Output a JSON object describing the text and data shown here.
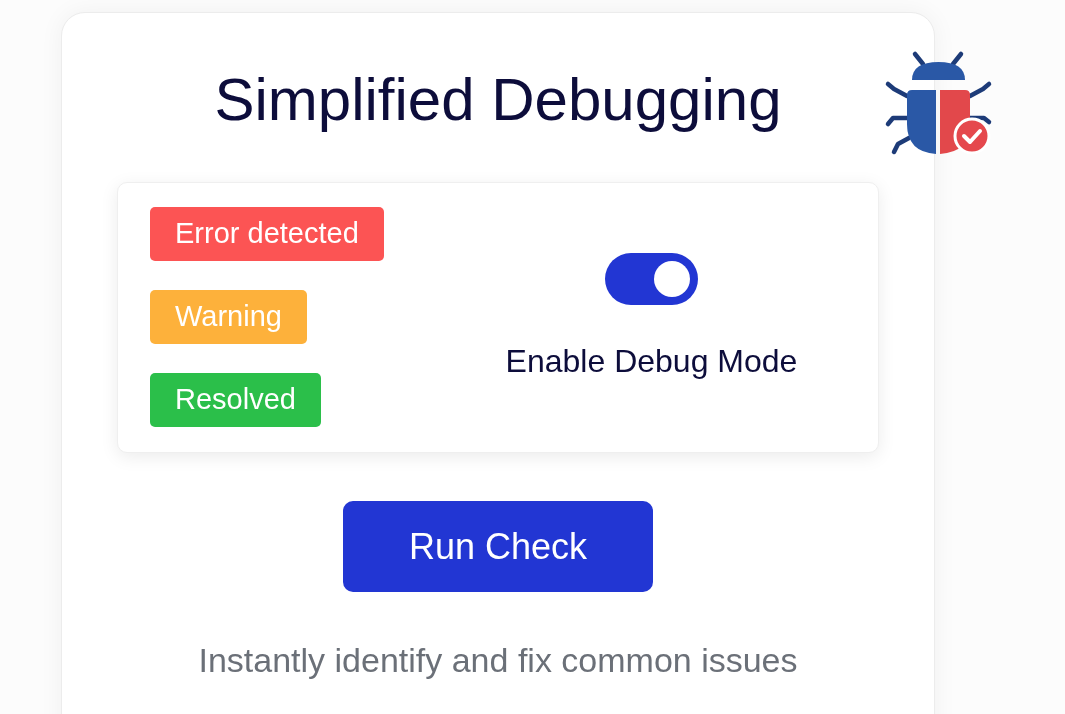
{
  "title": "Simplified Debugging",
  "status_badges": [
    {
      "label": "Error detected",
      "color": "#fc5454"
    },
    {
      "label": "Warning",
      "color": "#fdb13b"
    },
    {
      "label": "Resolved",
      "color": "#2bbf4a"
    }
  ],
  "debug_toggle": {
    "label": "Enable Debug Mode",
    "on": true
  },
  "run_button": {
    "label": "Run Check"
  },
  "caption": "Instantly identify and fix common issues"
}
